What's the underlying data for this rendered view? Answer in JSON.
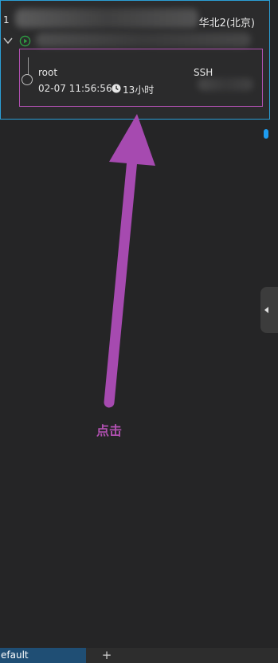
{
  "session": {
    "index": "1",
    "region": "华北2(北京)",
    "user": "root",
    "protocol": "SSH",
    "login_time": "02-07 11:56:56",
    "duration": "13小时"
  },
  "annotation": {
    "label": "点击",
    "color": "#b050b0"
  },
  "bottom_bar": {
    "active_tab": "efault",
    "add_symbol": "+"
  },
  "colors": {
    "background": "#252526",
    "selection_border": "#2b9fd6",
    "scroll_accent": "#1e9cf0",
    "tab_active": "#1f4e74",
    "status_running": "#2ea043"
  },
  "icons": [
    "chevron-down-icon",
    "play-circle-icon",
    "clock-icon",
    "collapse-left-icon",
    "plus-icon"
  ]
}
